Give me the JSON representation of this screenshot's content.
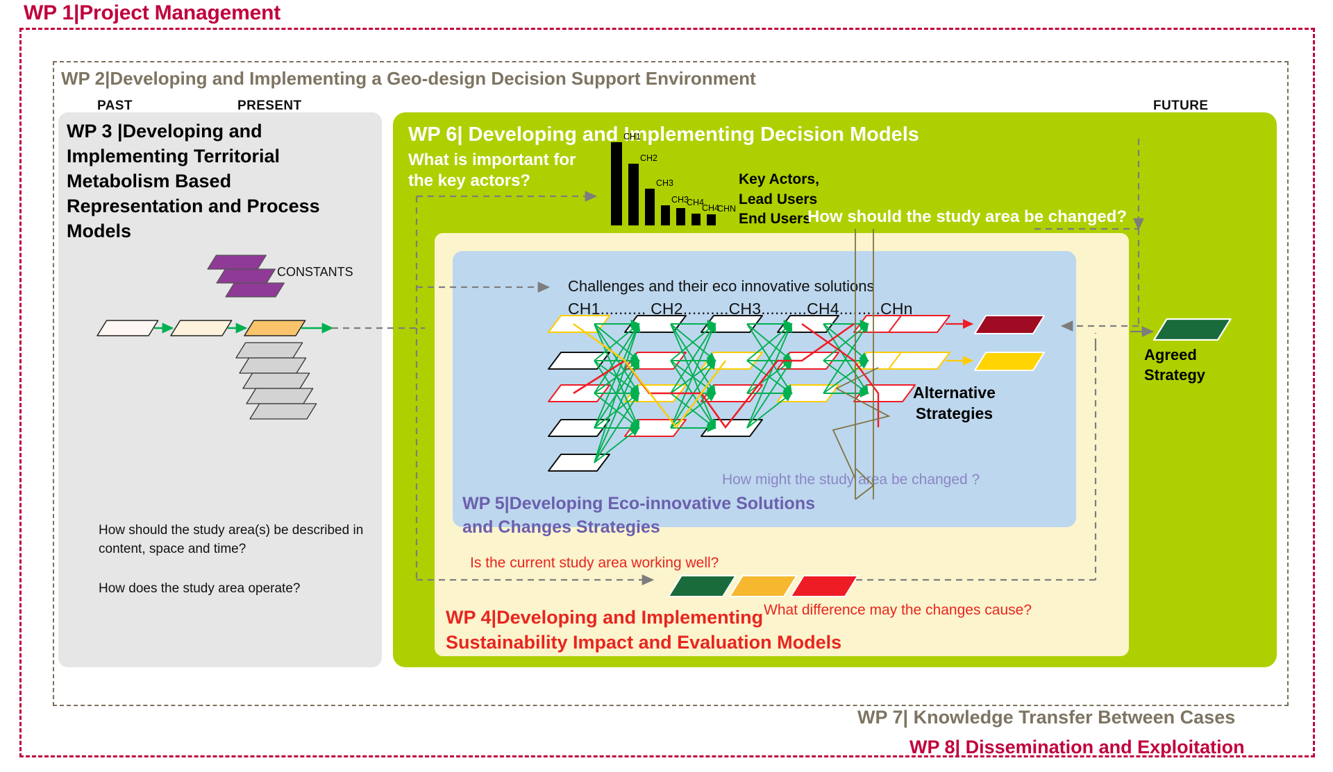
{
  "wp1": {
    "label": "WP 1|Project Management",
    "color": "#c0003c"
  },
  "wp2": {
    "label": "WP 2|Developing and Implementing  a Geo-design Decision Support Environment",
    "color": "#7d7462"
  },
  "timeline": {
    "past": "PAST",
    "present": "PRESENT",
    "future": "FUTURE"
  },
  "wp3": {
    "title": "WP 3 |Developing and Implementing Territorial Metabolism Based Representation and Process Models",
    "constants_label": "CONSTANTS",
    "question1": "How should the study area(s) be described in content, space and time?",
    "question2": "How does the study area operate?",
    "panel_color": "#e6e6e6",
    "constants_color": "#8e3a96"
  },
  "wp6": {
    "title": "WP 6| Developing and Implementing Decision Models",
    "question": "What is important for the key  actors?",
    "key_actors": "Key Actors,\nLead Users\nEnd Users",
    "key_actors_lines": [
      "Key Actors,",
      "Lead Users",
      "End Users"
    ],
    "how_changed": "How should the study area be changed?",
    "panel_color": "#aed000"
  },
  "wp4": {
    "title_line1": "WP 4|Developing and Implementing",
    "title_line2": "Sustainability Impact and Evaluation Models",
    "question_left": "Is the current study area working well?",
    "question_right": "What difference may the changes cause?",
    "panel_color": "#fbf4cd",
    "text_color": "#e8251f"
  },
  "wp5": {
    "title_line1": "WP 5|Developing Eco-innovative Solutions",
    "title_line2": "and Changes Strategies",
    "how_might": "How might the study area be changed ?",
    "challenges_heading": "Challenges and their eco innovative solutions",
    "challenges_channels": "CH1.......... CH2..........CH3..........CH4.........CHn",
    "panel_color": "#bdd7ee",
    "text_color": "#6b5fae"
  },
  "alternative_strategies": {
    "line1": "Alternative",
    "line2": "Strategies"
  },
  "agreed_strategy": {
    "line1": "Agreed",
    "line2": "Strategy",
    "color": "#1a6b3c"
  },
  "wp7": {
    "label": "WP 7| Knowledge Transfer Between Cases",
    "color": "#7d7462"
  },
  "wp8": {
    "label": "WP 8| Dissemination and Exploitation",
    "color": "#c0003c"
  },
  "chart_data": {
    "type": "bar",
    "title": "",
    "categories": [
      "CH1",
      "CH2",
      "CH3",
      "CH3",
      "CH4",
      "CH4",
      "CHN"
    ],
    "values": [
      100,
      74,
      44,
      24,
      21,
      14,
      13
    ],
    "xlabel": "",
    "ylabel": "",
    "ylim": [
      0,
      100
    ],
    "grid": false,
    "legend": "none",
    "bar_color": "#000000"
  }
}
